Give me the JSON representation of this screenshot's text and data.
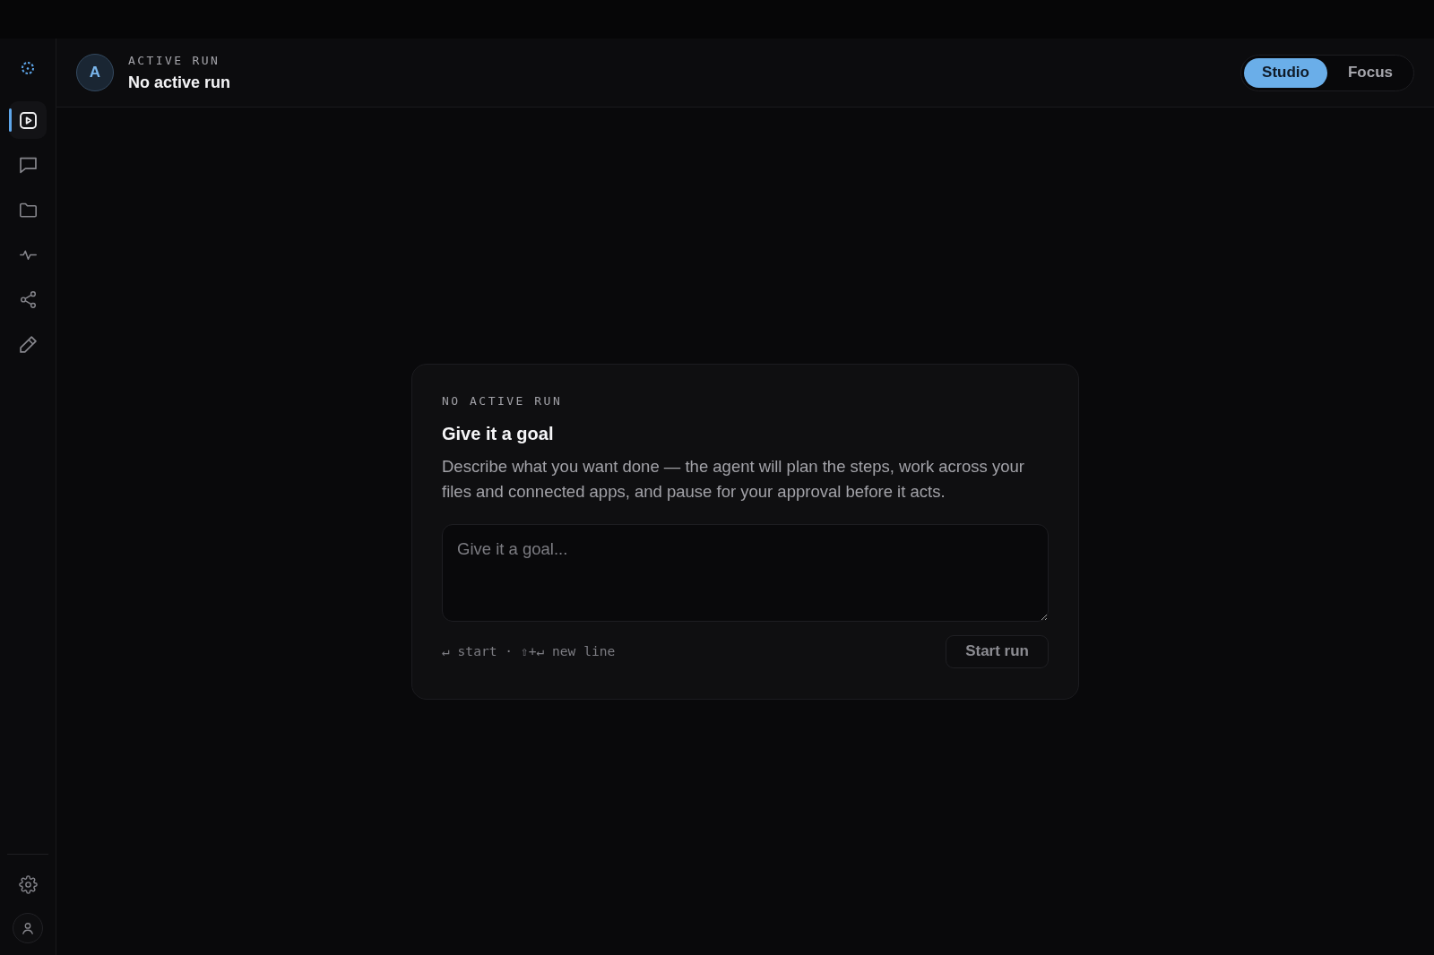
{
  "sidebar": {
    "items": [
      {
        "selected": true
      },
      {
        "selected": false
      },
      {
        "selected": false
      },
      {
        "selected": false
      },
      {
        "selected": false
      },
      {
        "selected": false
      }
    ]
  },
  "header": {
    "avatar": "A",
    "eyebrow": "ACTIVE RUN",
    "title": "No active run",
    "modes": [
      {
        "label": "Studio",
        "selected": true
      },
      {
        "label": "Focus",
        "selected": false
      }
    ]
  },
  "card": {
    "eyebrow": "NO ACTIVE RUN",
    "title": "Give it a goal",
    "description": "Describe what you want done — the agent will plan the steps, work across your files and connected apps, and pause for your approval before it acts.",
    "goal_input": {
      "placeholder": "Give it a goal..."
    },
    "hint": "↵ start · ⇧+↵ new line",
    "start_button": {
      "label": "Start run",
      "disabled": true
    }
  }
}
